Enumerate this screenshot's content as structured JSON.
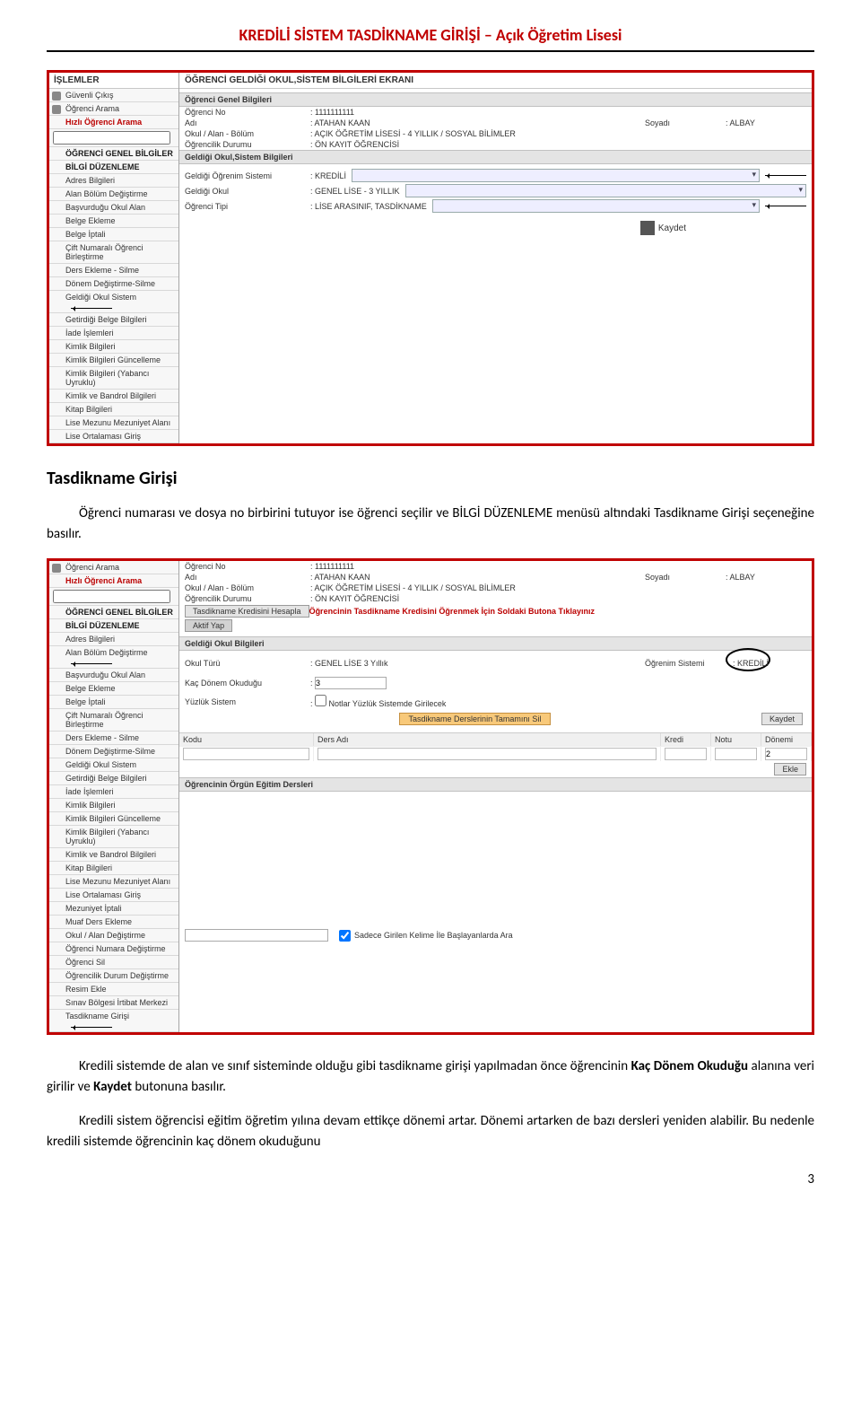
{
  "header_title": "KREDİLİ SİSTEM TASDİKNAME GİRİŞİ – Açık Öğretim Lisesi",
  "section_heading": "Tasdikname Girişi",
  "para1": "Öğrenci numarası ve dosya no birbirini tutuyor ise öğrenci seçilir ve BİLGİ DÜZENLEME menüsü altındaki Tasdikname Girişi seçeneğine basılır.",
  "para2a": "Kredili sistemde de alan ve sınıf sisteminde olduğu gibi tasdikname girişi yapılmadan önce öğrencinin ",
  "para2b": "Kaç Dönem Okuduğu",
  "para2c": " alanına veri girilir ve ",
  "para2d": "Kaydet",
  "para2e": " butonuna basılır.",
  "para3": "Kredili sistem öğrencisi eğitim öğretim yılına devam ettikçe dönemi artar. Dönemi artarken de bazı dersleri yeniden alabilir. Bu nedenle kredili sistemde öğrencinin kaç dönem okuduğunu",
  "page_number": "3",
  "shot1": {
    "islemler": "İŞLEMLER",
    "guvenli": "Güvenli Çıkış",
    "ogrenci_arama": "Öğrenci Arama",
    "hizli": "Hızlı Öğrenci Arama",
    "g1": "ÖĞRENCİ GENEL BİLGİLER",
    "g2": "BİLGİ DÜZENLEME",
    "menu": [
      "Adres Bilgileri",
      "Alan Bölüm Değiştirme",
      "Başvurduğu Okul Alan",
      "Belge Ekleme",
      "Belge İptali",
      "Çift Numaralı Öğrenci Birleştirme",
      "Ders Ekleme - Silme",
      "Dönem Değiştirme-Silme",
      "Geldiği Okul Sistem",
      "Getirdiği Belge Bilgileri",
      "İade İşlemleri",
      "Kimlik Bilgileri",
      "Kimlik Bilgileri Güncelleme",
      "Kimlik Bilgileri (Yabancı Uyruklu)",
      "Kimlik ve Bandrol Bilgileri",
      "Kitap Bilgileri",
      "Lise Mezunu Mezuniyet Alanı",
      "Lise Ortalaması Giriş"
    ],
    "panel_title": "ÖĞRENCİ GELDİĞİ OKUL,SİSTEM BİLGİLERİ EKRANI",
    "sep1": "Öğrenci Genel Bilgileri",
    "ogr_no_l": "Öğrenci No",
    "ogr_no_v": ": 1111111111",
    "adi_l": "Adı",
    "adi_v": ": ATAHAN KAAN",
    "soyadi_l": "Soyadı",
    "soyadi_v": ": ALBAY",
    "okul_l": "Okul / Alan - Bölüm",
    "okul_v": ": AÇIK ÖĞRETİM LİSESİ - 4 YILLIK / SOSYAL BİLİMLER",
    "durum_l": "Öğrencilik Durumu",
    "durum_v": ": ÖN KAYIT ÖĞRENCİSİ",
    "sep2": "Geldiği Okul,Sistem Bilgileri",
    "gsistem_l": "Geldiği Öğrenim Sistemi",
    "gsistem_v": ": KREDİLİ",
    "gokul_l": "Geldiği Okul",
    "gokul_v": ": GENEL LİSE - 3 YILLIK",
    "otip_l": "Öğrenci Tipi",
    "otip_v": ": LİSE ARASINIF, TASDİKNAME",
    "kaydet": "Kaydet"
  },
  "shot2": {
    "ogrenci_arama": "Öğrenci Arama",
    "hizli": "Hızlı Öğrenci Arama",
    "g1": "ÖĞRENCİ GENEL BİLGİLER",
    "g2": "BİLGİ DÜZENLEME",
    "menu": [
      "Adres Bilgileri",
      "Alan Bölüm Değiştirme",
      "Başvurduğu Okul Alan",
      "Belge Ekleme",
      "Belge İptali",
      "Çift Numaralı Öğrenci Birleştirme",
      "Ders Ekleme - Silme",
      "Dönem Değiştirme-Silme",
      "Geldiği Okul Sistem",
      "Getirdiği Belge Bilgileri",
      "İade İşlemleri",
      "Kimlik Bilgileri",
      "Kimlik Bilgileri Güncelleme",
      "Kimlik Bilgileri (Yabancı Uyruklu)",
      "Kimlik ve Bandrol Bilgileri",
      "Kitap Bilgileri",
      "Lise Mezunu Mezuniyet Alanı",
      "Lise Ortalaması Giriş",
      "Mezuniyet İptali",
      "Muaf Ders Ekleme",
      "Okul / Alan Değiştirme",
      "Öğrenci Numara Değiştirme",
      "Öğrenci Sil",
      "Öğrencilik Durum Değiştirme",
      "Resim Ekle",
      "Sınav Bölgesi İrtibat Merkezi",
      "Tasdikname Girişi"
    ],
    "ogr_no_l": "Öğrenci No",
    "ogr_no_v": ": 1111111111",
    "adi_l": "Adı",
    "adi_v": ": ATAHAN KAAN",
    "soyadi_l": "Soyadı",
    "soyadi_v": ": ALBAY",
    "okul_l": "Okul / Alan - Bölüm",
    "okul_v": ": AÇIK ÖĞRETİM LİSESİ - 4 YILLIK / SOSYAL BİLİMLER",
    "durum_l": "Öğrencilik Durumu",
    "durum_v": ": ÖN KAYIT ÖĞRENCİSİ",
    "hesapla_btn": "Tasdikname Kredisini Hesapla",
    "hesapla_msg": "Öğrencinin Tasdikname Kredisini Öğrenmek İçin Soldaki Butona Tıklayınız",
    "aktif_btn": "Aktif Yap",
    "sep_gob": "Geldiği Okul Bilgileri",
    "okul_turu_l": "Okul Türü",
    "okul_turu_v": ": GENEL LİSE 3 Yıllık",
    "ogr_sistem_l": "Öğrenim Sistemi",
    "ogr_sistem_v": ": KREDİLİ",
    "kac_donem_l": "Kaç Dönem Okuduğu",
    "kac_donem_v": "3",
    "yuzluk_l": "Yüzlük Sistem",
    "yuzluk_chk": "Notlar Yüzlük Sistemde Girilecek",
    "sil_btn": "Tasdikname Derslerinin Tamamını Sil",
    "kaydet": "Kaydet",
    "th_kodu": "Kodu",
    "th_ders": "Ders Adı",
    "th_kredi": "Kredi",
    "th_notu": "Notu",
    "th_don": "Dönemi",
    "row_don_v": "2",
    "ekle": "Ekle",
    "sep_orgun": "Öğrencinin Örgün Eğitim Dersleri",
    "search_label": "Sadece Girilen Kelime İle Başlayanlarda Ara"
  }
}
